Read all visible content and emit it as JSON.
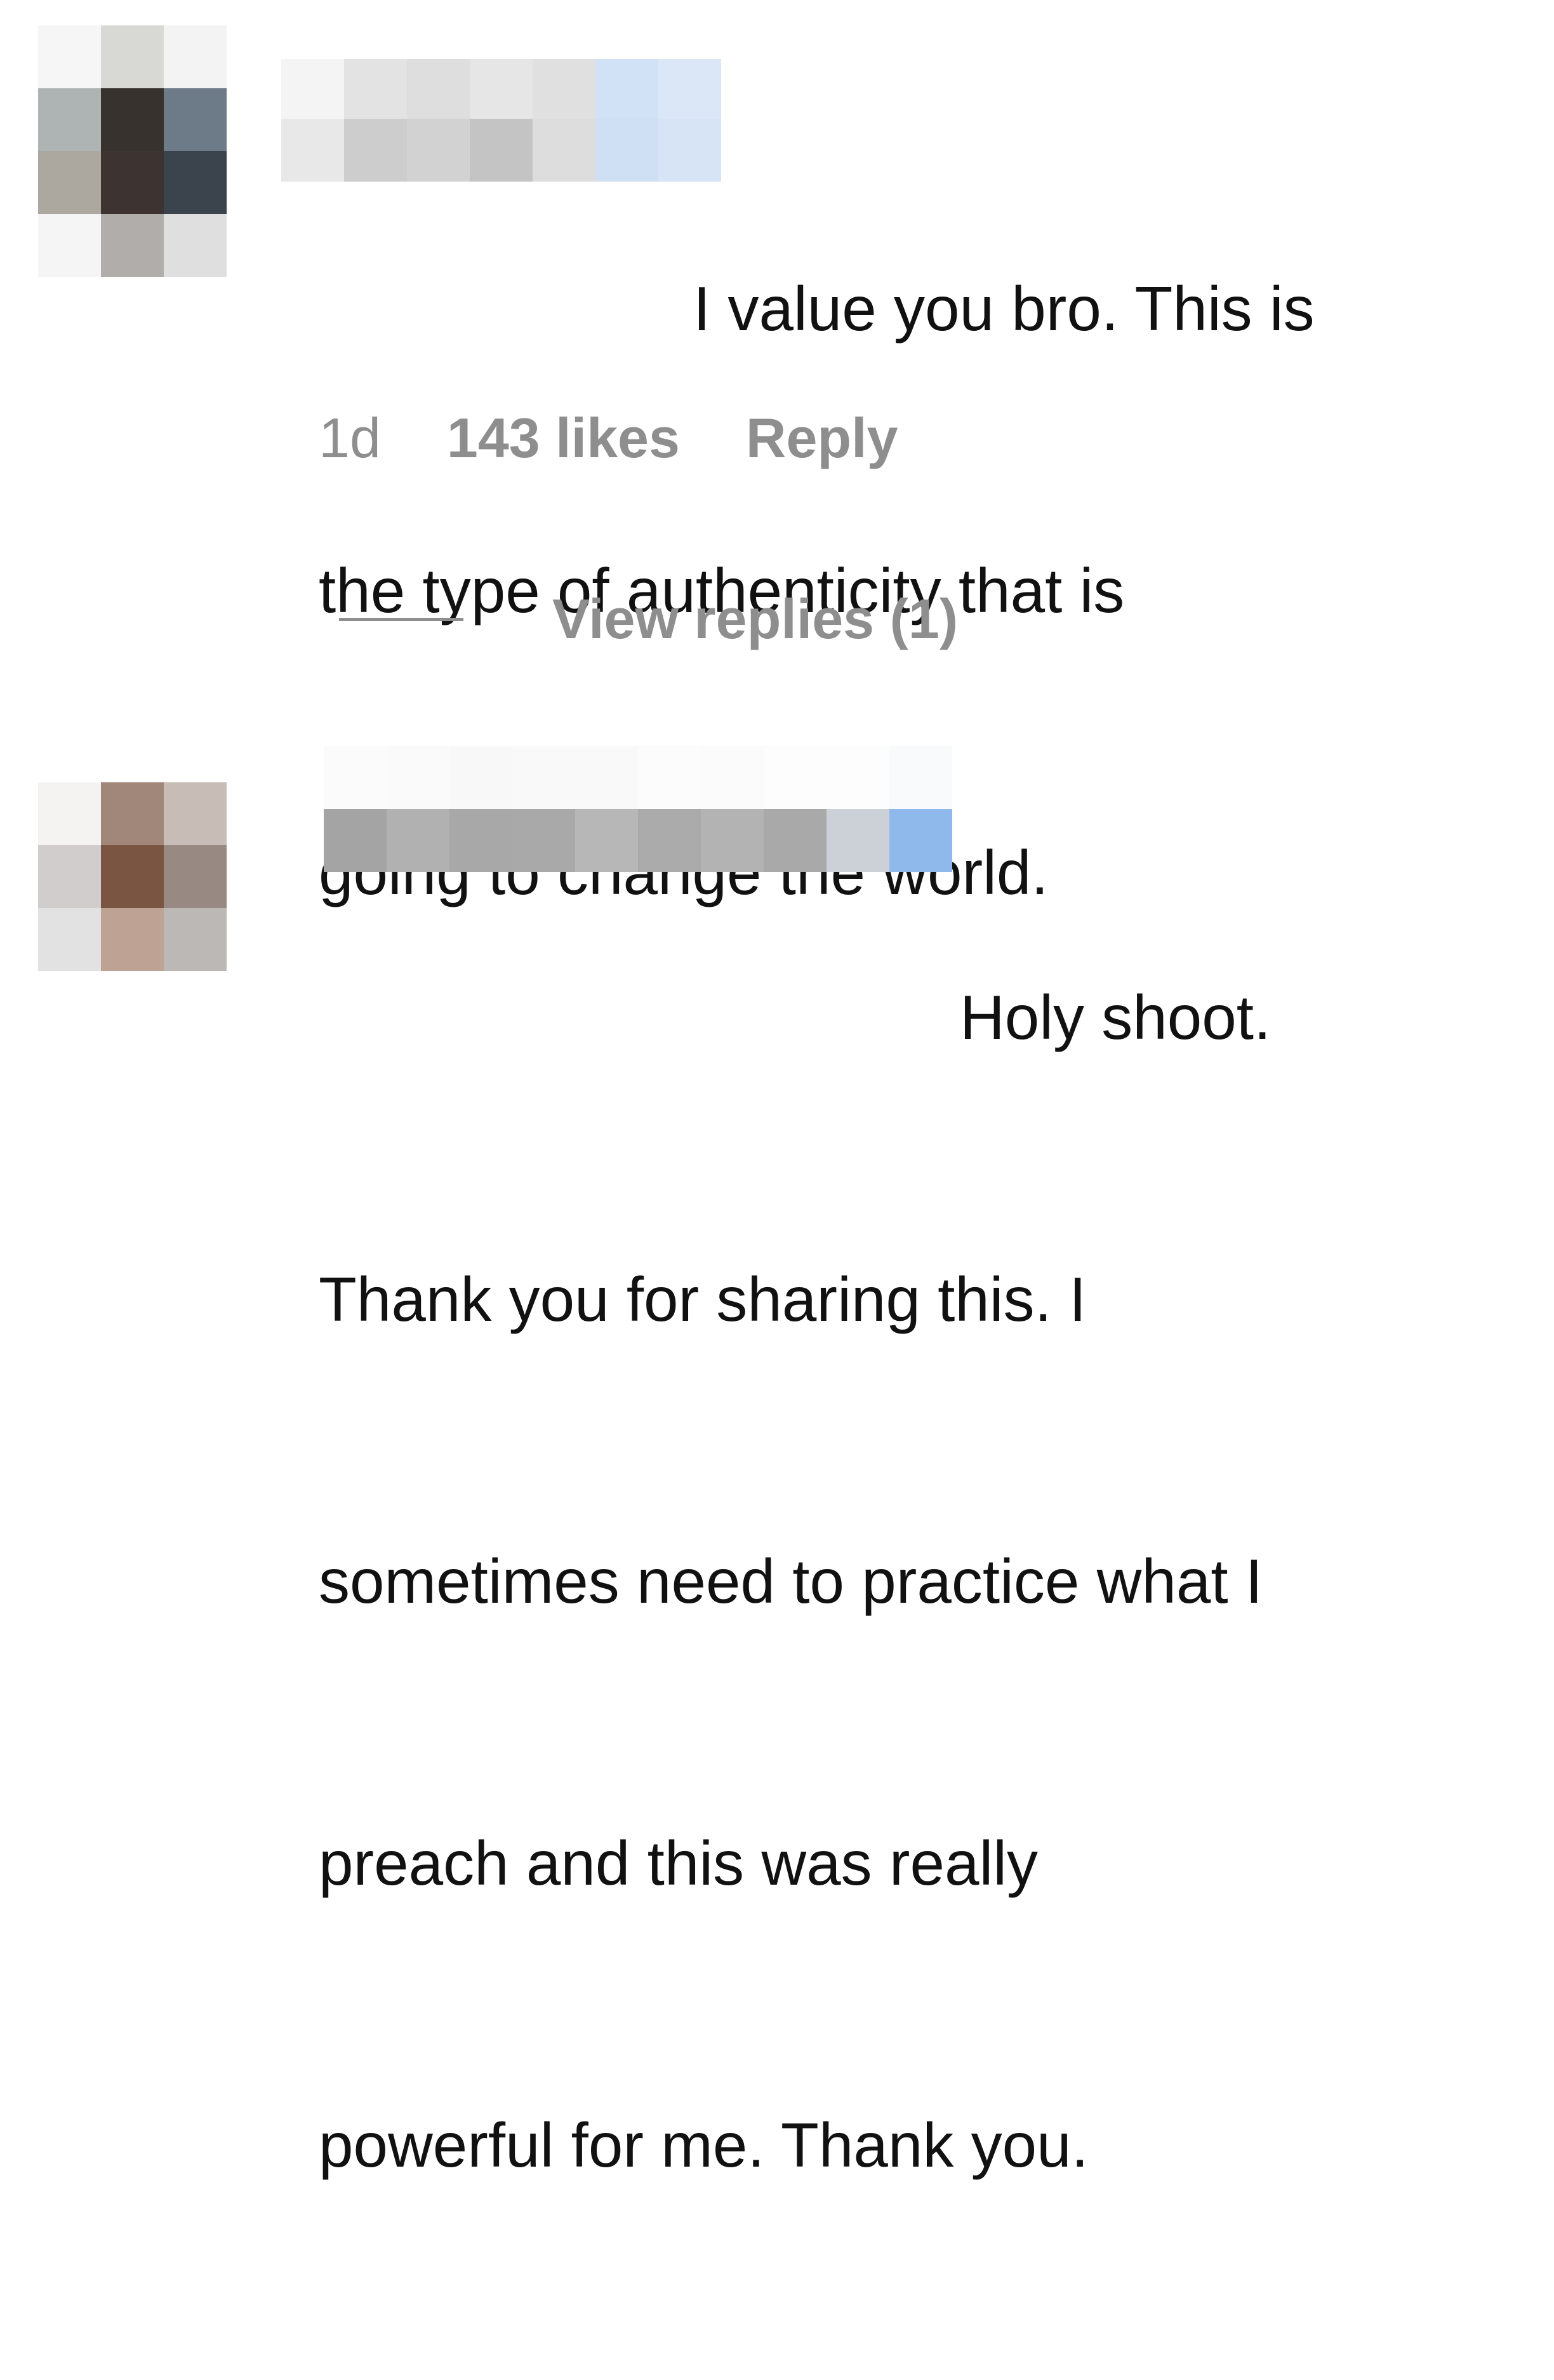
{
  "comments": [
    {
      "avatar_mosaic": [
        [
          "#f6f6f6",
          "#d8d9d5",
          "#f3f3f3"
        ],
        [
          "#aeb3b4",
          "#38322e",
          "#6d7a88"
        ],
        [
          "#aca79f",
          "#3d3330",
          "#3b434c"
        ],
        [
          "#f5f5f5",
          "#b1adab",
          "#dfdfe0"
        ]
      ],
      "username_mosaic": [
        [
          "#f4f4f4",
          "#e3e3e3",
          "#dedede",
          "#e6e6e6",
          "#e0e0e0",
          "#d2e2f6",
          "#dbe7f7"
        ],
        [
          "#e8e8e8",
          "#cdcdcd",
          "#d2d2d2",
          "#c4c4c4",
          "#dddddd",
          "#cfdff4",
          "#d7e4f6"
        ]
      ],
      "text_lines": [
        "I value you bro. This is",
        "the type of authenticity that is",
        "going to change the world."
      ],
      "time": "1d",
      "likes": "143 likes",
      "reply_label": "Reply",
      "view_replies": "View replies (1)"
    },
    {
      "avatar_mosaic": [
        [
          "#f4f3f2",
          "#a18779",
          "#c7bdb6"
        ],
        [
          "#d1cdcc",
          "#7a5542",
          "#988a82"
        ],
        [
          "#e3e2e2",
          "#bea394",
          "#bcb8b6"
        ]
      ],
      "username_mosaic": [
        [
          "#fbfbfb",
          "#fafafa",
          "#f8f8f8",
          "#f9f9f9",
          "#f9f9f9",
          "#fcfcfc",
          "#fbfbfb",
          "#fdfdfd",
          "#fdfdfd",
          "#f8fafc"
        ],
        [
          "#a4a4a4",
          "#b1b1b1",
          "#a8a8a8",
          "#a9a9a9",
          "#b7b7b7",
          "#ababab",
          "#b3b3b3",
          "#a9a9a9",
          "#ccd1d8",
          "#8fb9ea"
        ]
      ],
      "text_lines": [
        "Holy shoot.",
        "Thank you for sharing this. I",
        "sometimes need to practice what I",
        "preach and this was really",
        "powerful for me. Thank you."
      ]
    }
  ]
}
